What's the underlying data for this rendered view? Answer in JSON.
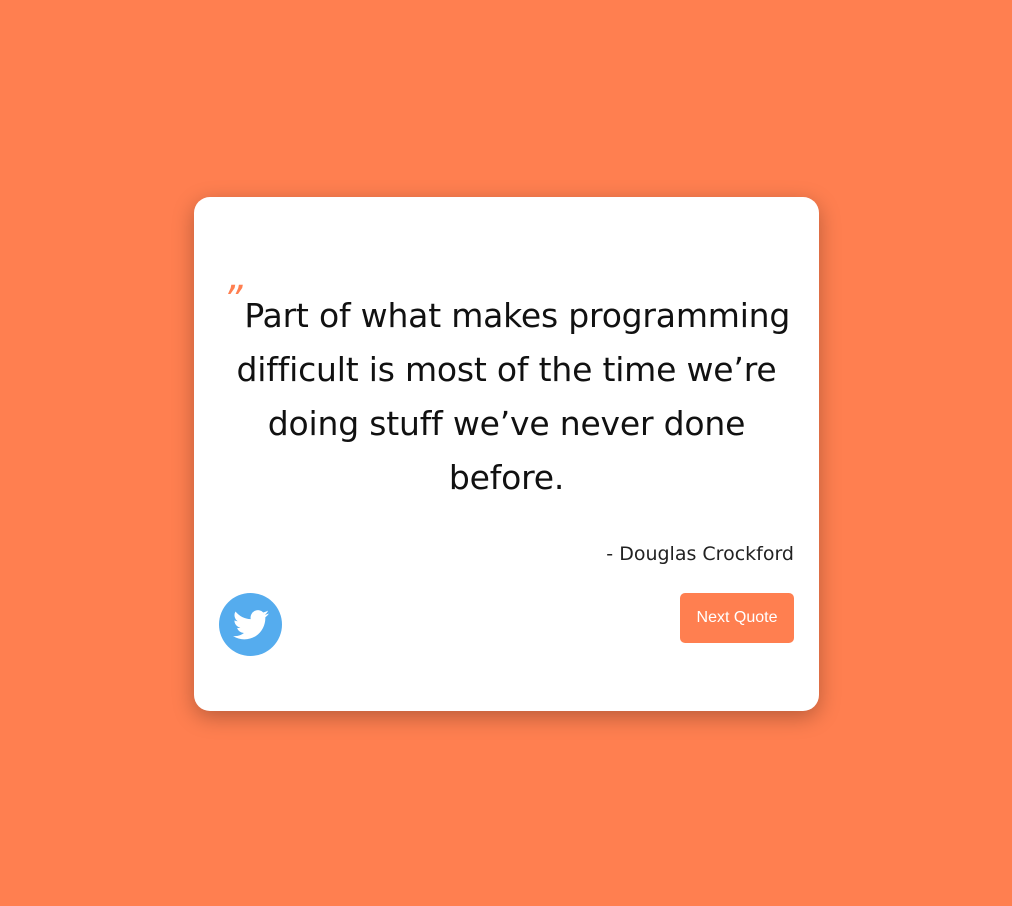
{
  "colors": {
    "background": "#FF7F50",
    "card": "#FFFFFF",
    "accent": "#FF7F50",
    "twitter": "#55ACEE",
    "text": "#111111"
  },
  "quote": {
    "mark": "”",
    "text": "Part of what makes programming difficult is most of the time we’re doing stuff we’ve never done before.",
    "author": "- Douglas Crockford"
  },
  "actions": {
    "tweet_icon": "twitter-bird-icon",
    "next_label": "Next Quote"
  }
}
